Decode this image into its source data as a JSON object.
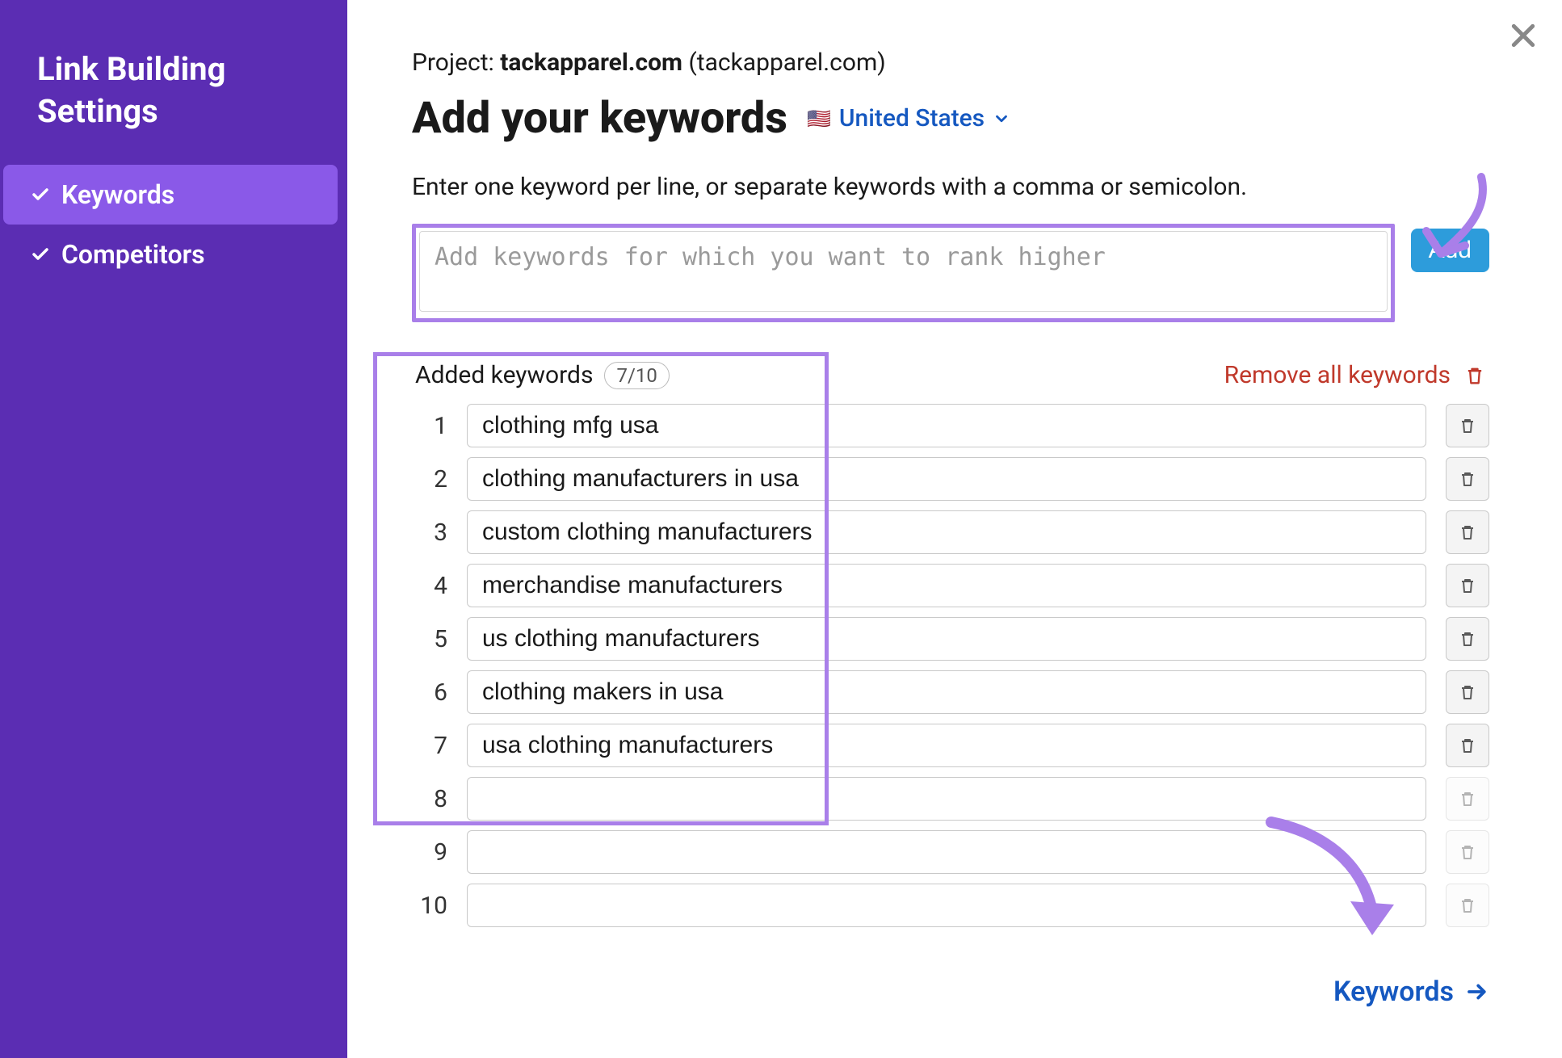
{
  "sidebar": {
    "title_line1": "Link Building",
    "title_line2": "Settings",
    "items": [
      {
        "label": "Keywords",
        "checked": true,
        "active": true
      },
      {
        "label": "Competitors",
        "checked": true,
        "active": false
      }
    ]
  },
  "header": {
    "project_prefix": "Project: ",
    "project_domain": "tackapparel.com",
    "project_parens": " (tackapparel.com)",
    "page_title": "Add your keywords",
    "flag": "🇺🇸",
    "location_label": "United States"
  },
  "instructions": "Enter one keyword per line, or separate keywords with a comma or semicolon.",
  "add_input": {
    "placeholder": "Add keywords for which you want to rank higher",
    "button_label": "Add"
  },
  "added": {
    "label": "Added keywords",
    "count_text": "7/10",
    "remove_all_label": "Remove all keywords"
  },
  "keywords": [
    {
      "num": "1",
      "value": "clothing mfg usa",
      "filled": true
    },
    {
      "num": "2",
      "value": "clothing manufacturers in usa",
      "filled": true
    },
    {
      "num": "3",
      "value": "custom clothing manufacturers",
      "filled": true
    },
    {
      "num": "4",
      "value": "merchandise manufacturers",
      "filled": true
    },
    {
      "num": "5",
      "value": "us clothing manufacturers",
      "filled": true
    },
    {
      "num": "6",
      "value": "clothing makers in usa",
      "filled": true
    },
    {
      "num": "7",
      "value": "usa clothing manufacturers",
      "filled": true
    },
    {
      "num": "8",
      "value": "",
      "filled": false
    },
    {
      "num": "9",
      "value": "",
      "filled": false
    },
    {
      "num": "10",
      "value": "",
      "filled": false
    }
  ],
  "footer": {
    "next_label": "Keywords"
  },
  "colors": {
    "accent_purple": "#5b2db3",
    "highlight_purple": "#a97fe9",
    "link_blue": "#1558c0",
    "add_btn_blue": "#2d9cdb",
    "danger_red": "#c0392b"
  }
}
